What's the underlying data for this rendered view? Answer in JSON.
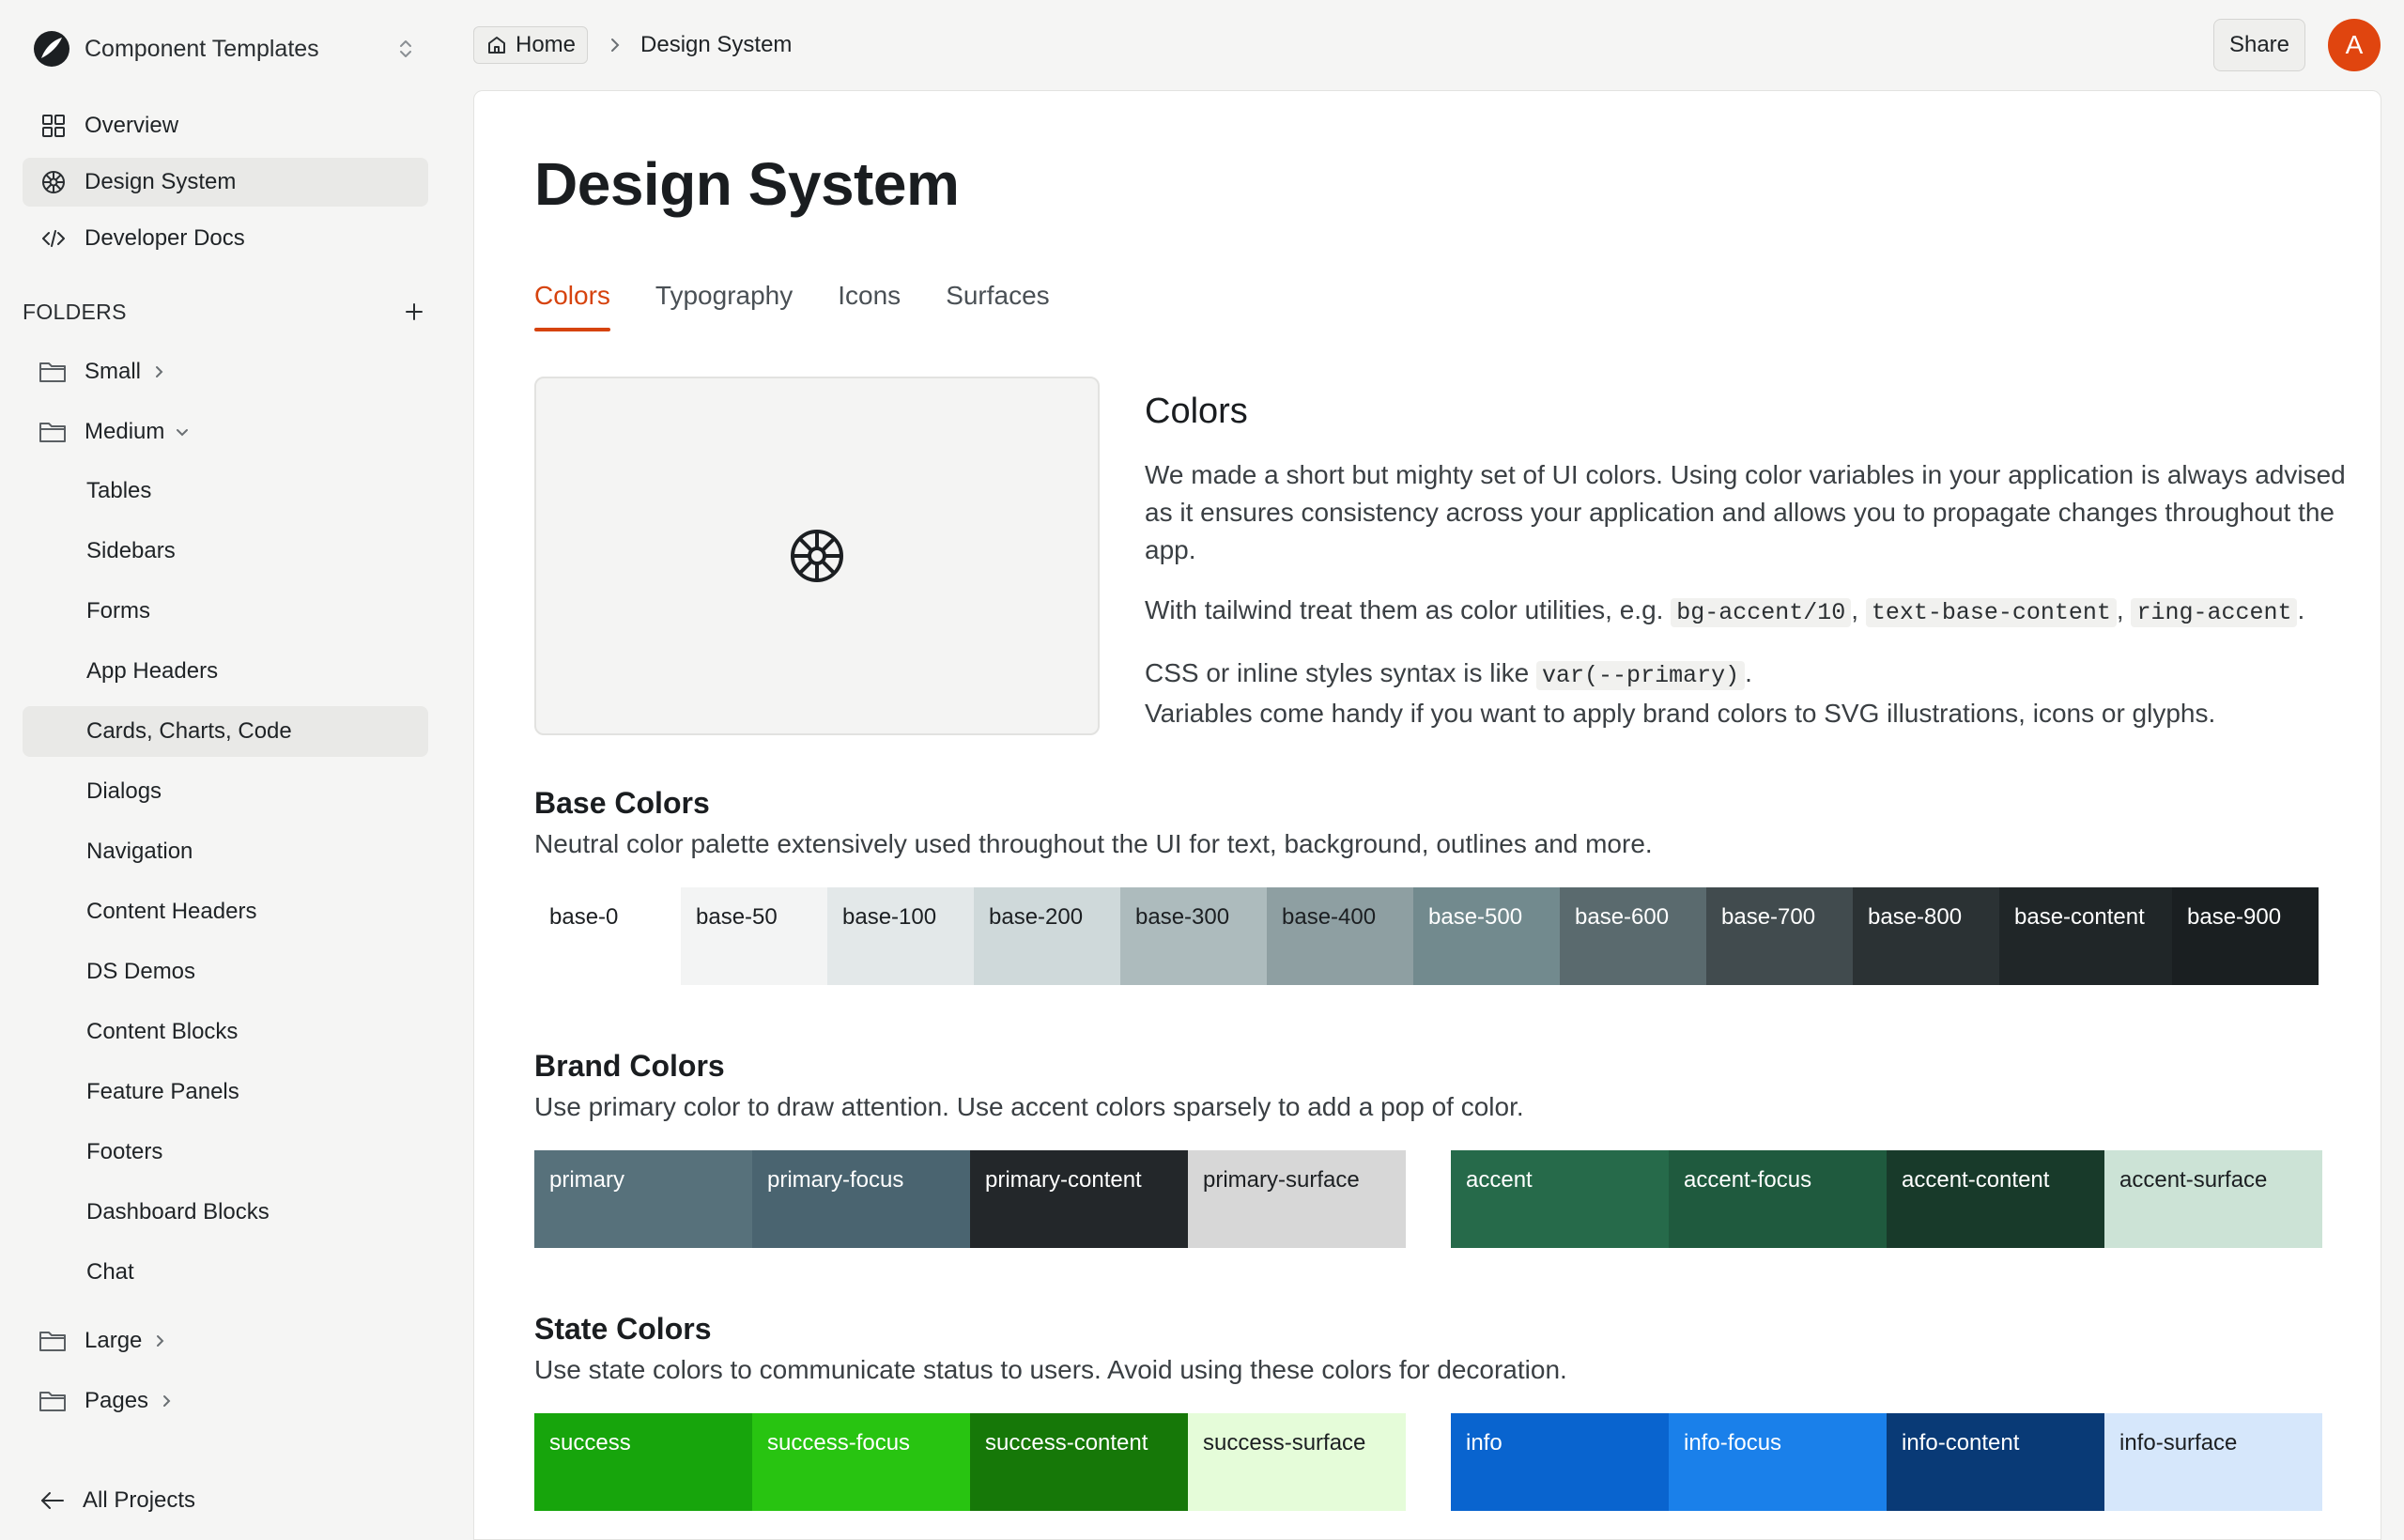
{
  "sidebar": {
    "workspace_name": "Component Templates",
    "nav": [
      {
        "label": "Overview",
        "icon": "grid-icon"
      },
      {
        "label": "Design System",
        "icon": "palette-icon",
        "active": true
      },
      {
        "label": "Developer Docs",
        "icon": "code-icon"
      }
    ],
    "folders_heading": "FOLDERS",
    "folders": {
      "small": "Small",
      "medium": "Medium",
      "medium_items": [
        "Tables",
        "Sidebars",
        "Forms",
        "App Headers",
        "Cards, Charts, Code",
        "Dialogs",
        "Navigation",
        "Content Headers",
        "DS Demos",
        "Content Blocks",
        "Feature Panels",
        "Footers",
        "Dashboard Blocks",
        "Chat"
      ],
      "medium_active_index": 4,
      "large": "Large",
      "pages": "Pages"
    },
    "all_projects": "All Projects"
  },
  "header": {
    "breadcrumb_home": "Home",
    "breadcrumb_current": "Design System",
    "share_label": "Share",
    "avatar_initial": "A"
  },
  "main": {
    "title": "Design System",
    "tabs": [
      "Colors",
      "Typography",
      "Icons",
      "Surfaces"
    ],
    "active_tab": 0,
    "intro": {
      "heading": "Colors",
      "p1": "We made a short but mighty set of UI colors. Using color variables in your application is always advised as it ensures consistency across your application and allows you to propagate changes throughout the app.",
      "p2_prefix": "With tailwind treat them as color utilities, e.g.",
      "p2_codes": [
        "bg-accent/10",
        "text-base-content",
        "ring-accent"
      ],
      "p3_prefix": "CSS or inline styles syntax is like",
      "p3_code": "var(--primary)",
      "p3_rest": "Variables come handy if you want to apply brand colors to SVG illustrations, icons or glyphs."
    },
    "base": {
      "title": "Base Colors",
      "desc": "Neutral color palette extensively used throughout the UI for text, background, outlines and more.",
      "swatches": [
        {
          "name": "base-0",
          "bg": "#ffffff",
          "fg": "#1c1f22",
          "w": 156
        },
        {
          "name": "base-50",
          "bg": "#f3f4f4",
          "fg": "#1c1f22",
          "w": 156
        },
        {
          "name": "base-100",
          "bg": "#e3e8e9",
          "fg": "#1c1f22",
          "w": 156
        },
        {
          "name": "base-200",
          "bg": "#cfd9da",
          "fg": "#1c1f22",
          "w": 156
        },
        {
          "name": "base-300",
          "bg": "#adbbbd",
          "fg": "#1c1f22",
          "w": 156
        },
        {
          "name": "base-400",
          "bg": "#8e9fa2",
          "fg": "#1c1f22",
          "w": 156
        },
        {
          "name": "base-500",
          "bg": "#728a8e",
          "fg": "#ffffff",
          "w": 156
        },
        {
          "name": "base-600",
          "bg": "#5a6a6e",
          "fg": "#ffffff",
          "w": 156
        },
        {
          "name": "base-700",
          "bg": "#414b4e",
          "fg": "#ffffff",
          "w": 156
        },
        {
          "name": "base-800",
          "bg": "#2b3234",
          "fg": "#ffffff",
          "w": 156
        },
        {
          "name": "base-content",
          "bg": "#202628",
          "fg": "#ffffff",
          "w": 184
        },
        {
          "name": "base-900",
          "bg": "#1a1f21",
          "fg": "#ffffff",
          "w": 156
        }
      ]
    },
    "brand": {
      "title": "Brand Colors",
      "desc": "Use primary color to draw attention. Use accent colors sparsely to add a pop of color.",
      "primary": [
        {
          "name": "primary",
          "bg": "#57717b",
          "fg": "#ffffff"
        },
        {
          "name": "primary-focus",
          "bg": "#4a6470",
          "fg": "#ffffff"
        },
        {
          "name": "primary-content",
          "bg": "#23272a",
          "fg": "#ffffff"
        },
        {
          "name": "primary-surface",
          "bg": "#d7d7d7",
          "fg": "#1c1f22"
        }
      ],
      "accent": [
        {
          "name": "accent",
          "bg": "#266a4a",
          "fg": "#ffffff"
        },
        {
          "name": "accent-focus",
          "bg": "#1f5a3e",
          "fg": "#ffffff"
        },
        {
          "name": "accent-content",
          "bg": "#183a2a",
          "fg": "#ffffff"
        },
        {
          "name": "accent-surface",
          "bg": "#cce3d6",
          "fg": "#1c1f22"
        }
      ]
    },
    "state": {
      "title": "State Colors",
      "desc": "Use state colors to communicate status to users. Avoid using these colors for decoration.",
      "success": [
        {
          "name": "success",
          "bg": "#17a50c",
          "fg": "#ffffff"
        },
        {
          "name": "success-focus",
          "bg": "#28c411",
          "fg": "#ffffff"
        },
        {
          "name": "success-content",
          "bg": "#167808",
          "fg": "#ffffff"
        },
        {
          "name": "success-surface",
          "bg": "#e5fcd9",
          "fg": "#1c1f22"
        }
      ],
      "info": [
        {
          "name": "info",
          "bg": "#0964cf",
          "fg": "#ffffff"
        },
        {
          "name": "info-focus",
          "bg": "#1a80ea",
          "fg": "#ffffff"
        },
        {
          "name": "info-content",
          "bg": "#093a76",
          "fg": "#ffffff"
        },
        {
          "name": "info-surface",
          "bg": "#d6e7fb",
          "fg": "#1c1f22"
        }
      ]
    }
  },
  "colors": {
    "accent": "#d6430e",
    "sidebar_bg": "#f5f5f4",
    "active_bg": "#e9e9e7"
  }
}
